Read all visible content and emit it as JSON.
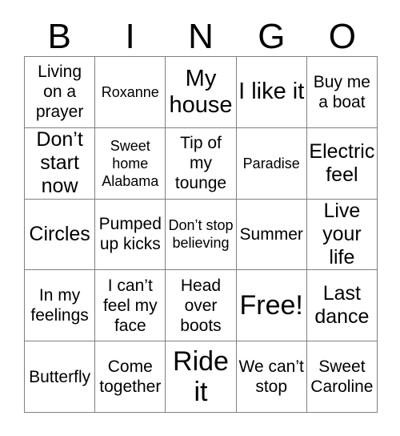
{
  "header": {
    "letters": [
      "B",
      "I",
      "N",
      "G",
      "O"
    ]
  },
  "grid": {
    "columns": 5,
    "rows": 5,
    "border_color": "#808080",
    "cell_background": "#ffffff",
    "text_color": "#000000",
    "cells": [
      [
        {
          "text": "Living on a prayer",
          "size": "md"
        },
        {
          "text": "Roxanne",
          "size": "sm"
        },
        {
          "text": "My house",
          "size": "xl"
        },
        {
          "text": "I like it",
          "size": "xl"
        },
        {
          "text": "Buy me a boat",
          "size": "md"
        }
      ],
      [
        {
          "text": "Don’t start now",
          "size": "lg"
        },
        {
          "text": "Sweet home Alabama",
          "size": "sm"
        },
        {
          "text": "Tip of my tounge",
          "size": "md"
        },
        {
          "text": "Paradise",
          "size": "sm"
        },
        {
          "text": "Electric feel",
          "size": "lg"
        }
      ],
      [
        {
          "text": "Circles",
          "size": "lg"
        },
        {
          "text": "Pumped up kicks",
          "size": "md"
        },
        {
          "text": "Don’t stop believing",
          "size": "sm"
        },
        {
          "text": "Summer",
          "size": "md"
        },
        {
          "text": "Live your life",
          "size": "lg"
        }
      ],
      [
        {
          "text": "In my feelings",
          "size": "md"
        },
        {
          "text": "I can’t feel my face",
          "size": "md"
        },
        {
          "text": "Head over boots",
          "size": "md"
        },
        {
          "text": "Free!",
          "size": "xxl"
        },
        {
          "text": "Last dance",
          "size": "lg"
        }
      ],
      [
        {
          "text": "Butterfly",
          "size": "md"
        },
        {
          "text": "Come together",
          "size": "md"
        },
        {
          "text": "Ride it",
          "size": "xxl"
        },
        {
          "text": "We can’t stop",
          "size": "md"
        },
        {
          "text": "Sweet Caroline",
          "size": "md"
        }
      ]
    ]
  }
}
